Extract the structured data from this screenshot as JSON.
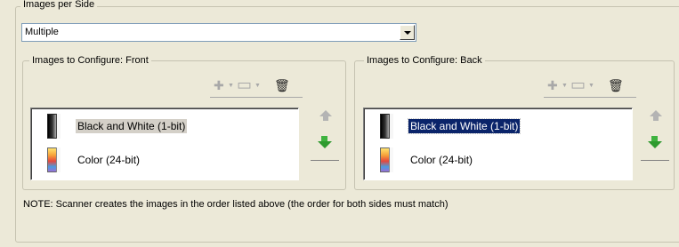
{
  "images_per_side": {
    "legend": "Images per Side",
    "selected_value": "Multiple"
  },
  "front": {
    "legend": "Images to Configure: Front",
    "items": [
      {
        "label": "Black and White (1-bit)",
        "icon": "bw-page-icon",
        "state": "selected-inactive"
      },
      {
        "label": "Color (24-bit)",
        "icon": "color-page-icon",
        "state": "normal"
      }
    ]
  },
  "back": {
    "legend": "Images to Configure: Back",
    "items": [
      {
        "label": "Black and White (1-bit)",
        "icon": "bw-page-icon",
        "state": "selected-focused"
      },
      {
        "label": "Color (24-bit)",
        "icon": "color-page-icon",
        "state": "normal"
      }
    ]
  },
  "toolbar_icons": [
    "add-icon",
    "remove-icon",
    "trash-icon"
  ],
  "move_buttons": [
    "move-up-icon",
    "move-down-icon"
  ],
  "note": "NOTE: Scanner creates the images in the order listed above (the order for both sides must match)",
  "colors": {
    "panel": "#ece9d8",
    "selection_focused": "#0a246a",
    "selection_inactive": "#d4d0c8",
    "down_arrow": "#2f9a2f"
  }
}
